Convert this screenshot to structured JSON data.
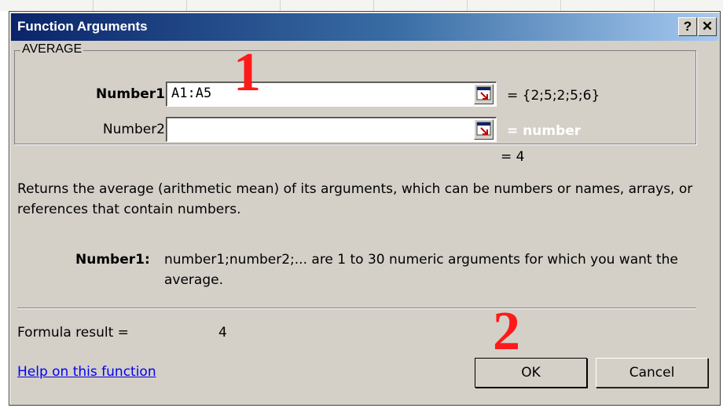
{
  "dialog": {
    "title": "Function Arguments",
    "help_button": "?",
    "close_button": "✕"
  },
  "function_group": {
    "legend": "AVERAGE",
    "arguments": [
      {
        "label": "Number1",
        "value": "A1:A5",
        "evaluated": "= {2;5;2;5;6}",
        "bold": true
      },
      {
        "label": "Number2",
        "value": "",
        "evaluated": "= number",
        "bold": false
      }
    ]
  },
  "result_preview": "= 4",
  "description": "Returns the average (arithmetic mean) of its arguments, which can be numbers or names, arrays, or references that contain numbers.",
  "argument_help": {
    "name": "Number1:",
    "text": "number1;number2;... are 1 to 30 numeric arguments for which you want the average."
  },
  "formula_result": {
    "label": "Formula result =",
    "value": "4"
  },
  "help_link": "Help on this function",
  "buttons": {
    "ok": "OK",
    "cancel": "Cancel"
  },
  "annotations": [
    "1",
    "2"
  ],
  "colors": {
    "titlebar_start": "#0a246a",
    "titlebar_end": "#a6caf0",
    "dialog_face": "#d4d0c8",
    "annotation": "#ff1a1a",
    "link": "#0000ee"
  }
}
